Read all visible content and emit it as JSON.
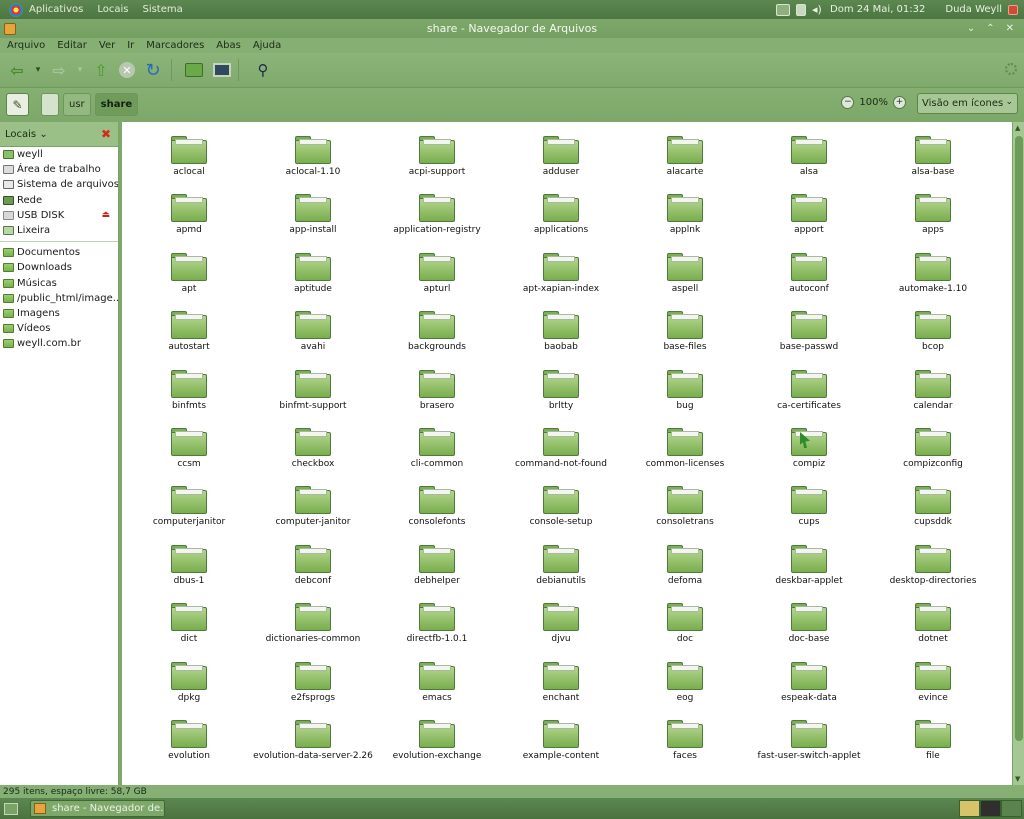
{
  "top_panel": {
    "menus": [
      "Aplicativos",
      "Locais",
      "Sistema"
    ],
    "datetime": "Dom 24 Mai, 01:32",
    "username": "Duda Weyll"
  },
  "window": {
    "title": "share - Navegador de Arquivos"
  },
  "menubar": [
    "Arquivo",
    "Editar",
    "Ver",
    "Ir",
    "Marcadores",
    "Abas",
    "Ajuda"
  ],
  "locbar": {
    "crumbs": [
      "usr",
      "share"
    ],
    "zoom": "100%",
    "view_mode": "Visão em ícones"
  },
  "sidebar": {
    "header": "Locais",
    "places": [
      {
        "label": "weyll",
        "icon": "home-icon"
      },
      {
        "label": "Área de trabalho",
        "icon": "desktop-icon"
      },
      {
        "label": "Sistema de arquivos",
        "icon": "filesystem-icon"
      },
      {
        "label": "Rede",
        "icon": "network-icon"
      },
      {
        "label": "USB DISK",
        "icon": "usb-drive-icon"
      },
      {
        "label": "Lixeira",
        "icon": "trash-icon"
      }
    ],
    "bookmarks": [
      {
        "label": "Documentos"
      },
      {
        "label": "Downloads"
      },
      {
        "label": "Músicas"
      },
      {
        "label": "/public_html/image..."
      },
      {
        "label": "Imagens"
      },
      {
        "label": "Vídeos"
      },
      {
        "label": "weyll.com.br"
      }
    ]
  },
  "files": [
    "aclocal",
    "aclocal-1.10",
    "acpi-support",
    "adduser",
    "alacarte",
    "alsa",
    "alsa-base",
    "apmd",
    "app-install",
    "application-registry",
    "applications",
    "applnk",
    "apport",
    "apps",
    "apt",
    "aptitude",
    "apturl",
    "apt-xapian-index",
    "aspell",
    "autoconf",
    "automake-1.10",
    "autostart",
    "avahi",
    "backgrounds",
    "baobab",
    "base-files",
    "base-passwd",
    "bcop",
    "binfmts",
    "binfmt-support",
    "brasero",
    "brltty",
    "bug",
    "ca-certificates",
    "calendar",
    "ccsm",
    "checkbox",
    "cli-common",
    "command-not-found",
    "common-licenses",
    "compiz",
    "compizconfig",
    "computerjanitor",
    "computer-janitor",
    "consolefonts",
    "console-setup",
    "consoletrans",
    "cups",
    "cupsddk",
    "dbus-1",
    "debconf",
    "debhelper",
    "debianutils",
    "defoma",
    "deskbar-applet",
    "desktop-directories",
    "dict",
    "dictionaries-common",
    "directfb-1.0.1",
    "djvu",
    "doc",
    "doc-base",
    "dotnet",
    "dpkg",
    "e2fsprogs",
    "emacs",
    "enchant",
    "eog",
    "espeak-data",
    "evince",
    "evolution",
    "evolution-data-server-2.26",
    "evolution-exchange",
    "example-content",
    "faces",
    "fast-user-switch-applet",
    "file"
  ],
  "special_folder": "compiz",
  "status": {
    "text": "295 itens, espaço livre: 58,7 GB"
  },
  "bottom_panel": {
    "task": "share - Navegador de..."
  },
  "colors": {
    "panel": "#5c8750",
    "chrome": "#86af73",
    "folder": "#79ad4f"
  }
}
